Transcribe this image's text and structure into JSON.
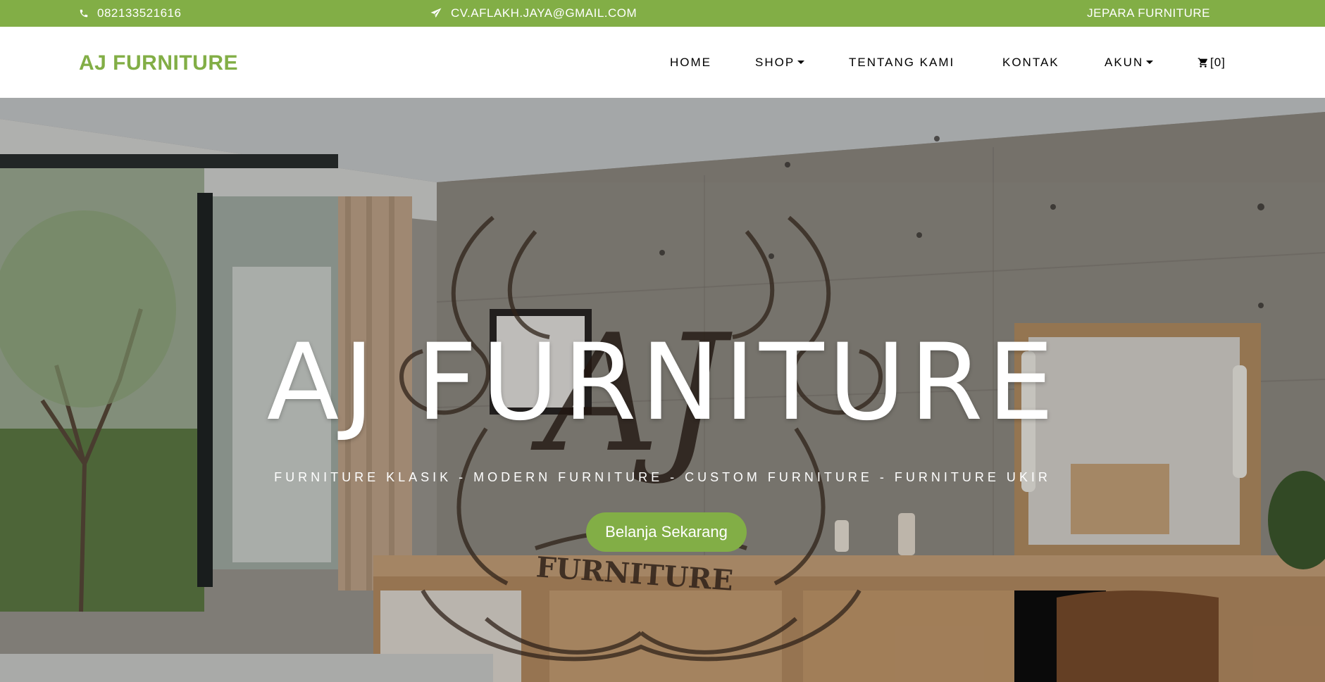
{
  "topbar": {
    "phone": "082133521616",
    "email": "CV.AFLAKH.JAYA@GMAIL.COM",
    "tagline": "JEPARA FURNITURE"
  },
  "navbar": {
    "brand": "AJ FURNITURE",
    "items": {
      "home": "HOME",
      "shop": "SHOP",
      "tentang": "TENTANG KAMI",
      "kontak": "KONTAK",
      "akun": "AKUN",
      "cart": "[0]"
    }
  },
  "hero": {
    "title": "AJ FURNITURE",
    "subtitle": "FURNITURE KLASIK - MODERN FURNITURE - CUSTOM FURNITURE - FURNITURE UKIR",
    "button": "Belanja Sekarang",
    "watermark_logo": "AJ FURNITURE"
  },
  "colors": {
    "brand_green": "#82ae46",
    "white": "#ffffff",
    "nav_text": "#000000"
  },
  "icons": {
    "phone": "phone-icon",
    "email": "paper-plane-icon",
    "cart": "cart-icon"
  }
}
